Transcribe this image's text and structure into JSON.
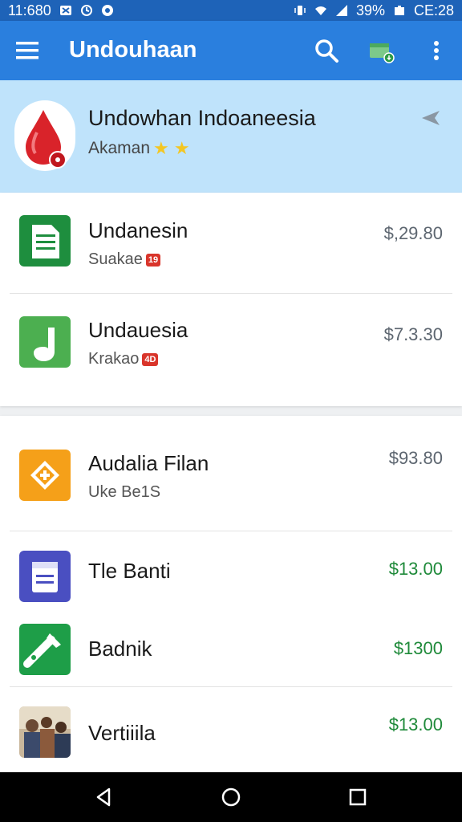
{
  "status_bar": {
    "time": "11:680",
    "battery": "39%",
    "clock_right": "CE:28"
  },
  "app_bar": {
    "title": "Undouhaan",
    "icons": [
      "menu-icon",
      "search-icon",
      "download-card-icon",
      "more-vert-icon"
    ]
  },
  "featured": {
    "title": "Undowhan Indoaneesia",
    "subtitle": "Akaman",
    "stars": "★ ★",
    "accent": "#bfe3fb"
  },
  "list1": [
    {
      "name": "Undanesin",
      "sub": "Suakae",
      "badge": "19",
      "price": "$,29.80",
      "icon": "document-icon"
    },
    {
      "name": "Undauesia",
      "sub": "Krakao",
      "badge": "4D",
      "price": "$7.3.30",
      "icon": "music-note-icon"
    }
  ],
  "list2": [
    {
      "name": "Audalia Filan",
      "sub": "Uke Be1S",
      "price": "$93.80",
      "icon": "film-icon"
    },
    {
      "name": "Tle Banti",
      "sub": "",
      "price": "$13.00",
      "icon": "notepad-icon"
    },
    {
      "name": "Badnik",
      "sub": "",
      "price": "$1300",
      "icon": "tool-icon"
    },
    {
      "name": "Vertiiila",
      "sub": "",
      "price": "$13.00",
      "icon": "photo-icon"
    }
  ],
  "colors": {
    "app_bar": "#2a7fde",
    "status_bar": "#1e63b8",
    "price_green": "#1f8a3a",
    "price_gray": "#5d6670"
  }
}
